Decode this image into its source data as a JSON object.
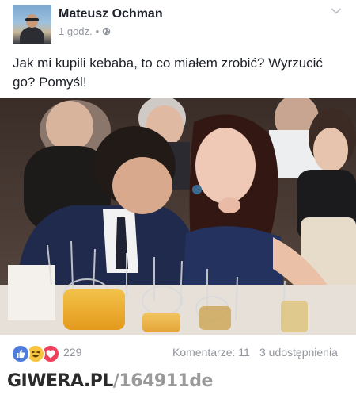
{
  "post": {
    "author": "Mateusz Ochman",
    "time": "1 godz.",
    "separator": "•",
    "audience_icon": "globe-icon",
    "menu_icon": "chevron-down-icon",
    "text": "Jak mi kupili kebaba, to co miałem zrobić? Wyrzucić go? Pomyśl!"
  },
  "photo": {
    "subject": "photo"
  },
  "reactions": {
    "icons": [
      "like-icon",
      "haha-icon",
      "love-icon"
    ],
    "count": "229",
    "comments": "Komentarze: 11",
    "shares": "3 udostępnienia"
  },
  "watermark": {
    "site": "GIWERA.PL",
    "id": "/164911de"
  },
  "colors": {
    "like": "#4e7ddb",
    "haha": "#f7c63e",
    "love": "#f0405b",
    "text": "#1d2129",
    "meta": "#90949c"
  }
}
